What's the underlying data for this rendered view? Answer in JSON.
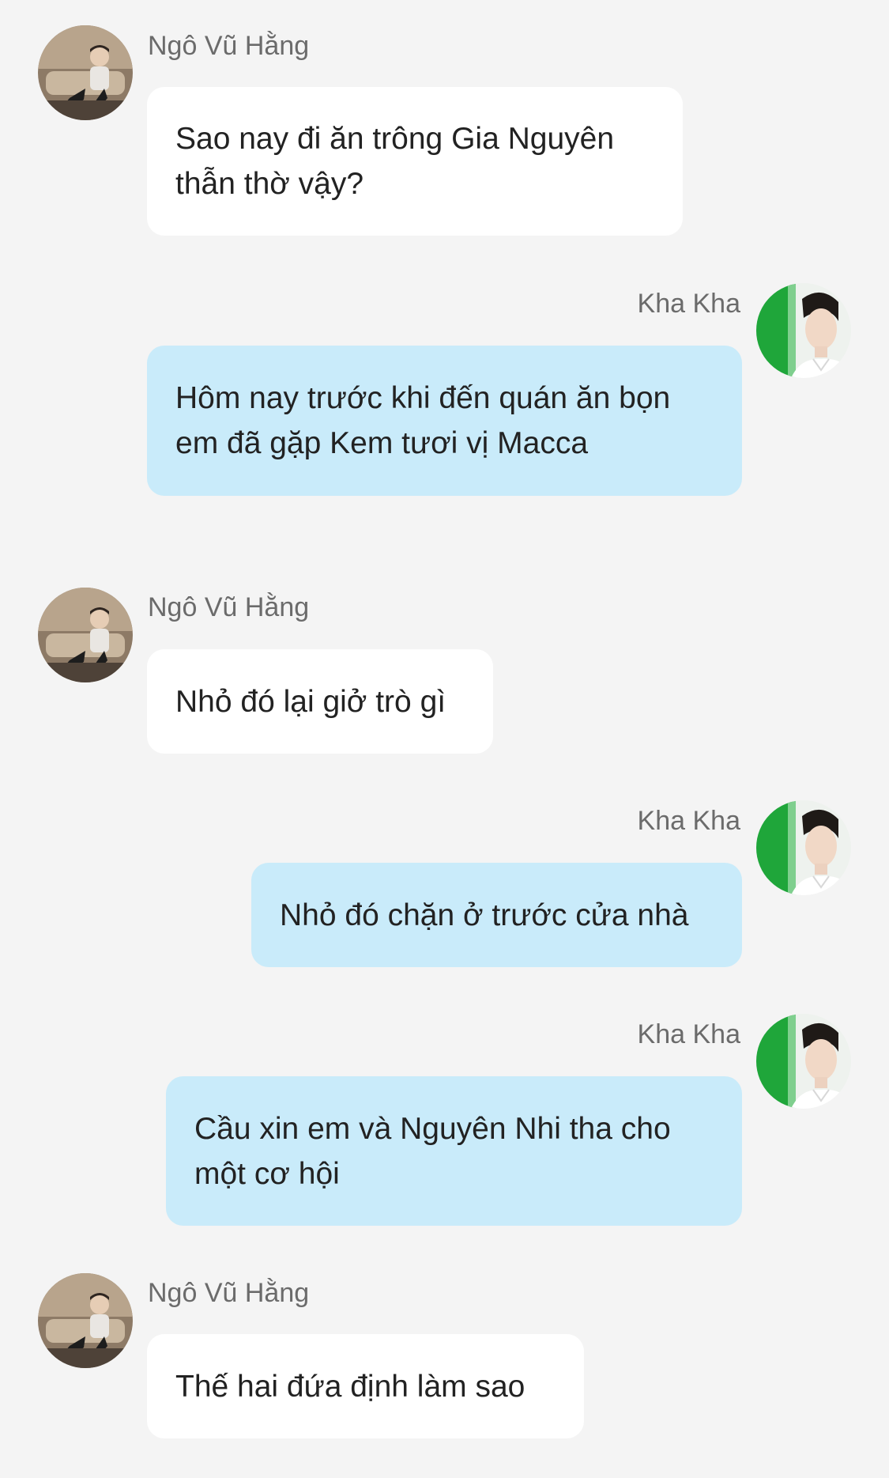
{
  "participants": {
    "other": {
      "name": "Ngô Vũ Hằng",
      "avatar_icon": "person-sitting-avatar-icon"
    },
    "self": {
      "name": "Kha Kha",
      "avatar_icon": "person-portrait-avatar-icon"
    }
  },
  "colors": {
    "background": "#f4f4f4",
    "incoming_bubble": "#ffffff",
    "outgoing_bubble": "#c9ebfa",
    "name_text": "#6b6b6b",
    "message_text": "#222222"
  },
  "messages": [
    {
      "sender": "Ngô Vũ Hằng",
      "direction": "incoming",
      "lines": [
        "Sao nay đi ăn trông Gia Nguyên",
        "thẫn thờ vậy?"
      ]
    },
    {
      "sender": "Kha Kha",
      "direction": "outgoing",
      "lines": [
        "Hôm nay trước khi đến quán ăn bọn",
        "em đã gặp Kem tươi vị Macca"
      ]
    },
    {
      "sender": "Ngô Vũ Hằng",
      "direction": "incoming",
      "lines": [
        "Nhỏ đó lại giở trò gì"
      ]
    },
    {
      "sender": "Kha Kha",
      "direction": "outgoing",
      "lines": [
        "Nhỏ đó chặn ở trước cửa nhà"
      ]
    },
    {
      "sender": "Kha Kha",
      "direction": "outgoing",
      "lines": [
        "Cầu xin em và Nguyên Nhi tha cho",
        "một cơ hội"
      ]
    },
    {
      "sender": "Ngô Vũ Hằng",
      "direction": "incoming",
      "lines": [
        "Thế hai đứa định làm sao"
      ]
    }
  ]
}
